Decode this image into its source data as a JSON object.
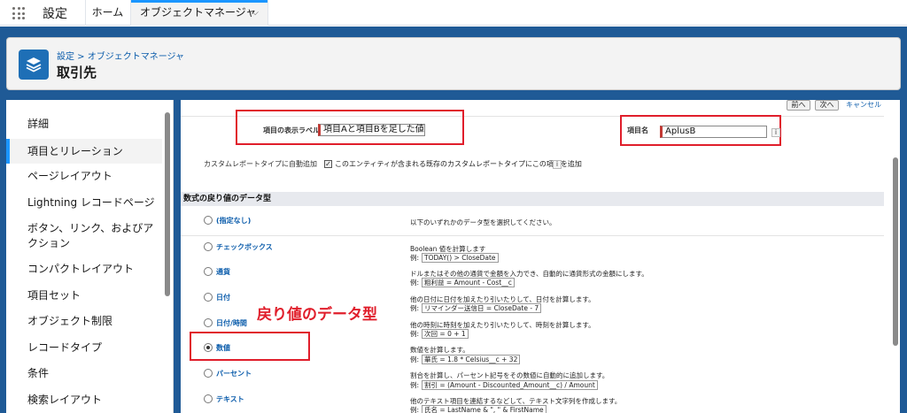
{
  "topbar": {
    "app_name": "設定",
    "tabs": [
      {
        "label": "ホーム"
      },
      {
        "label": "オブジェクトマネージャ"
      }
    ]
  },
  "header": {
    "breadcrumb": "設定 > オブジェクトマネージャ",
    "title": "取引先"
  },
  "sidebar": {
    "items": [
      {
        "label": "詳細"
      },
      {
        "label": "項目とリレーション"
      },
      {
        "label": "ページレイアウト"
      },
      {
        "label": "Lightning レコードページ"
      },
      {
        "label": "ボタン、リンク、およびア"
      },
      {
        "label": "クション"
      },
      {
        "label": "コンパクトレイアウト"
      },
      {
        "label": "項目セット"
      },
      {
        "label": "オブジェクト制限"
      },
      {
        "label": "レコードタイプ"
      },
      {
        "label": "条件"
      },
      {
        "label": "検索レイアウト"
      }
    ]
  },
  "form": {
    "buttons": {
      "prev": "前へ",
      "next": "次へ",
      "cancel": "キャンセル"
    },
    "display_label": "項目の表示ラベル",
    "display_value": "項目Aと項目Bを足した値",
    "field_name_label": "項目名",
    "field_name_value": "AplusB",
    "custom_report_label": "カスタムレポートタイプに自動追加",
    "custom_report_text": "このエンティティが含まれる既存のカスタムレポートタイプにこの項目を追加",
    "info": "i",
    "check": "✓"
  },
  "section_title": "数式の戻り値のデータ型",
  "types": [
    {
      "label": "(指定なし)",
      "desc": "以下のいずれかのデータ型を選択してください。",
      "example": "",
      "selected": false
    },
    {
      "label": "チェックボックス",
      "desc": "Boolean 値を計算します",
      "example": "TODAY() > CloseDate",
      "selected": false
    },
    {
      "label": "通貨",
      "desc": "ドルまたはその他の通貨で金額を入力でき、自動的に通貨形式の金額にします。",
      "example": "粗利益 = Amount - Cost__c",
      "selected": false
    },
    {
      "label": "日付",
      "desc": "他の日付に日付を加えたり引いたりして、日付を計算します。",
      "example": "リマインダー送信日 = CloseDate - 7",
      "selected": false
    },
    {
      "label": "日付/時間",
      "desc": "他の時刻に時刻を加えたり引いたりして、時刻を計算します。",
      "example": "次回 = 0 + 1",
      "selected": false
    },
    {
      "label": "数値",
      "desc": "数値を計算します。",
      "example": "華氏 = 1.8 * Celsius__c + 32",
      "selected": true
    },
    {
      "label": "パーセント",
      "desc": "割合を計算し、パーセント記号をその数値に自動的に追加します。",
      "example": "割引 = (Amount - Discounted_Amount__c) / Amount",
      "selected": false
    },
    {
      "label": "テキスト",
      "desc": "他のテキスト項目を連結するなどして、テキスト文字列を作成します。",
      "example": "氏名 = LastName & \", \" & FirstName",
      "selected": false
    }
  ],
  "example_prefix": "例:",
  "annotation": "戻り値のデータ型",
  "colors": {
    "accent": "#1b96ff",
    "brand": "#1f5a96",
    "highlight": "#e01e2b"
  }
}
